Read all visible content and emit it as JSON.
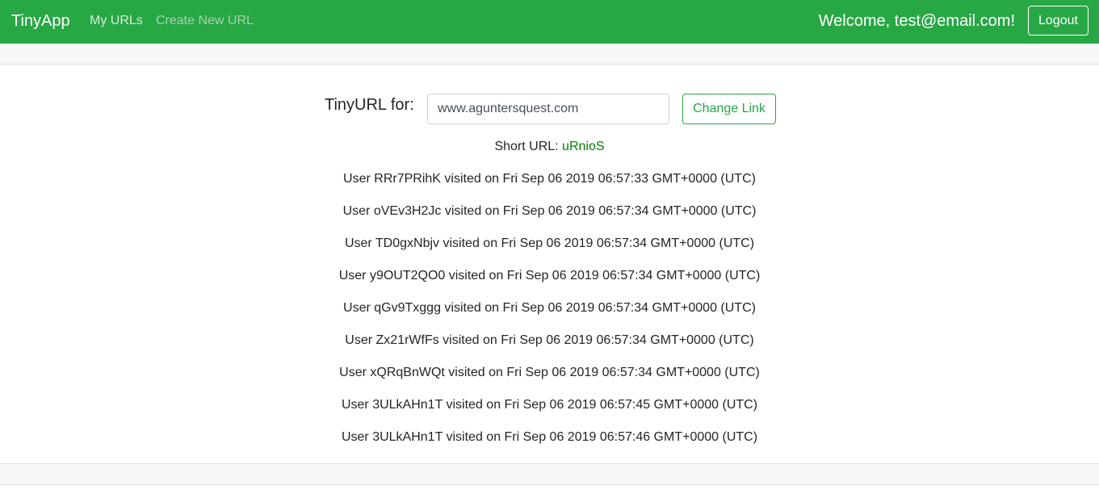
{
  "navbar": {
    "brand": "TinyApp",
    "links": [
      "My URLs",
      "Create New URL"
    ],
    "welcome_prefix": "Welcome, ",
    "user_email": "test@email.com",
    "welcome_suffix": "!",
    "logout_label": "Logout"
  },
  "form": {
    "label": "TinyURL for:",
    "long_url": "www.aguntersquest.com",
    "submit_label": "Change Link"
  },
  "short_url": {
    "label": "Short URL: ",
    "value": "uRnioS"
  },
  "visits": [
    {
      "user": "RRr7PRihK",
      "timestamp": "Fri Sep 06 2019 06:57:33 GMT+0000 (UTC)"
    },
    {
      "user": "oVEv3H2Jc",
      "timestamp": "Fri Sep 06 2019 06:57:34 GMT+0000 (UTC)"
    },
    {
      "user": "TD0gxNbjv",
      "timestamp": "Fri Sep 06 2019 06:57:34 GMT+0000 (UTC)"
    },
    {
      "user": "y9OUT2QO0",
      "timestamp": "Fri Sep 06 2019 06:57:34 GMT+0000 (UTC)"
    },
    {
      "user": "qGv9Txggg",
      "timestamp": "Fri Sep 06 2019 06:57:34 GMT+0000 (UTC)"
    },
    {
      "user": "Zx21rWfFs",
      "timestamp": "Fri Sep 06 2019 06:57:34 GMT+0000 (UTC)"
    },
    {
      "user": "xQRqBnWQt",
      "timestamp": "Fri Sep 06 2019 06:57:34 GMT+0000 (UTC)"
    },
    {
      "user": "3ULkAHn1T",
      "timestamp": "Fri Sep 06 2019 06:57:45 GMT+0000 (UTC)"
    },
    {
      "user": "3ULkAHn1T",
      "timestamp": "Fri Sep 06 2019 06:57:46 GMT+0000 (UTC)"
    }
  ],
  "visit_text": {
    "prefix": "User ",
    "middle": " visited on "
  },
  "colors": {
    "navbar_bg": "#28a745",
    "short_url_link": "#008000",
    "button_outline": "#28a745"
  }
}
